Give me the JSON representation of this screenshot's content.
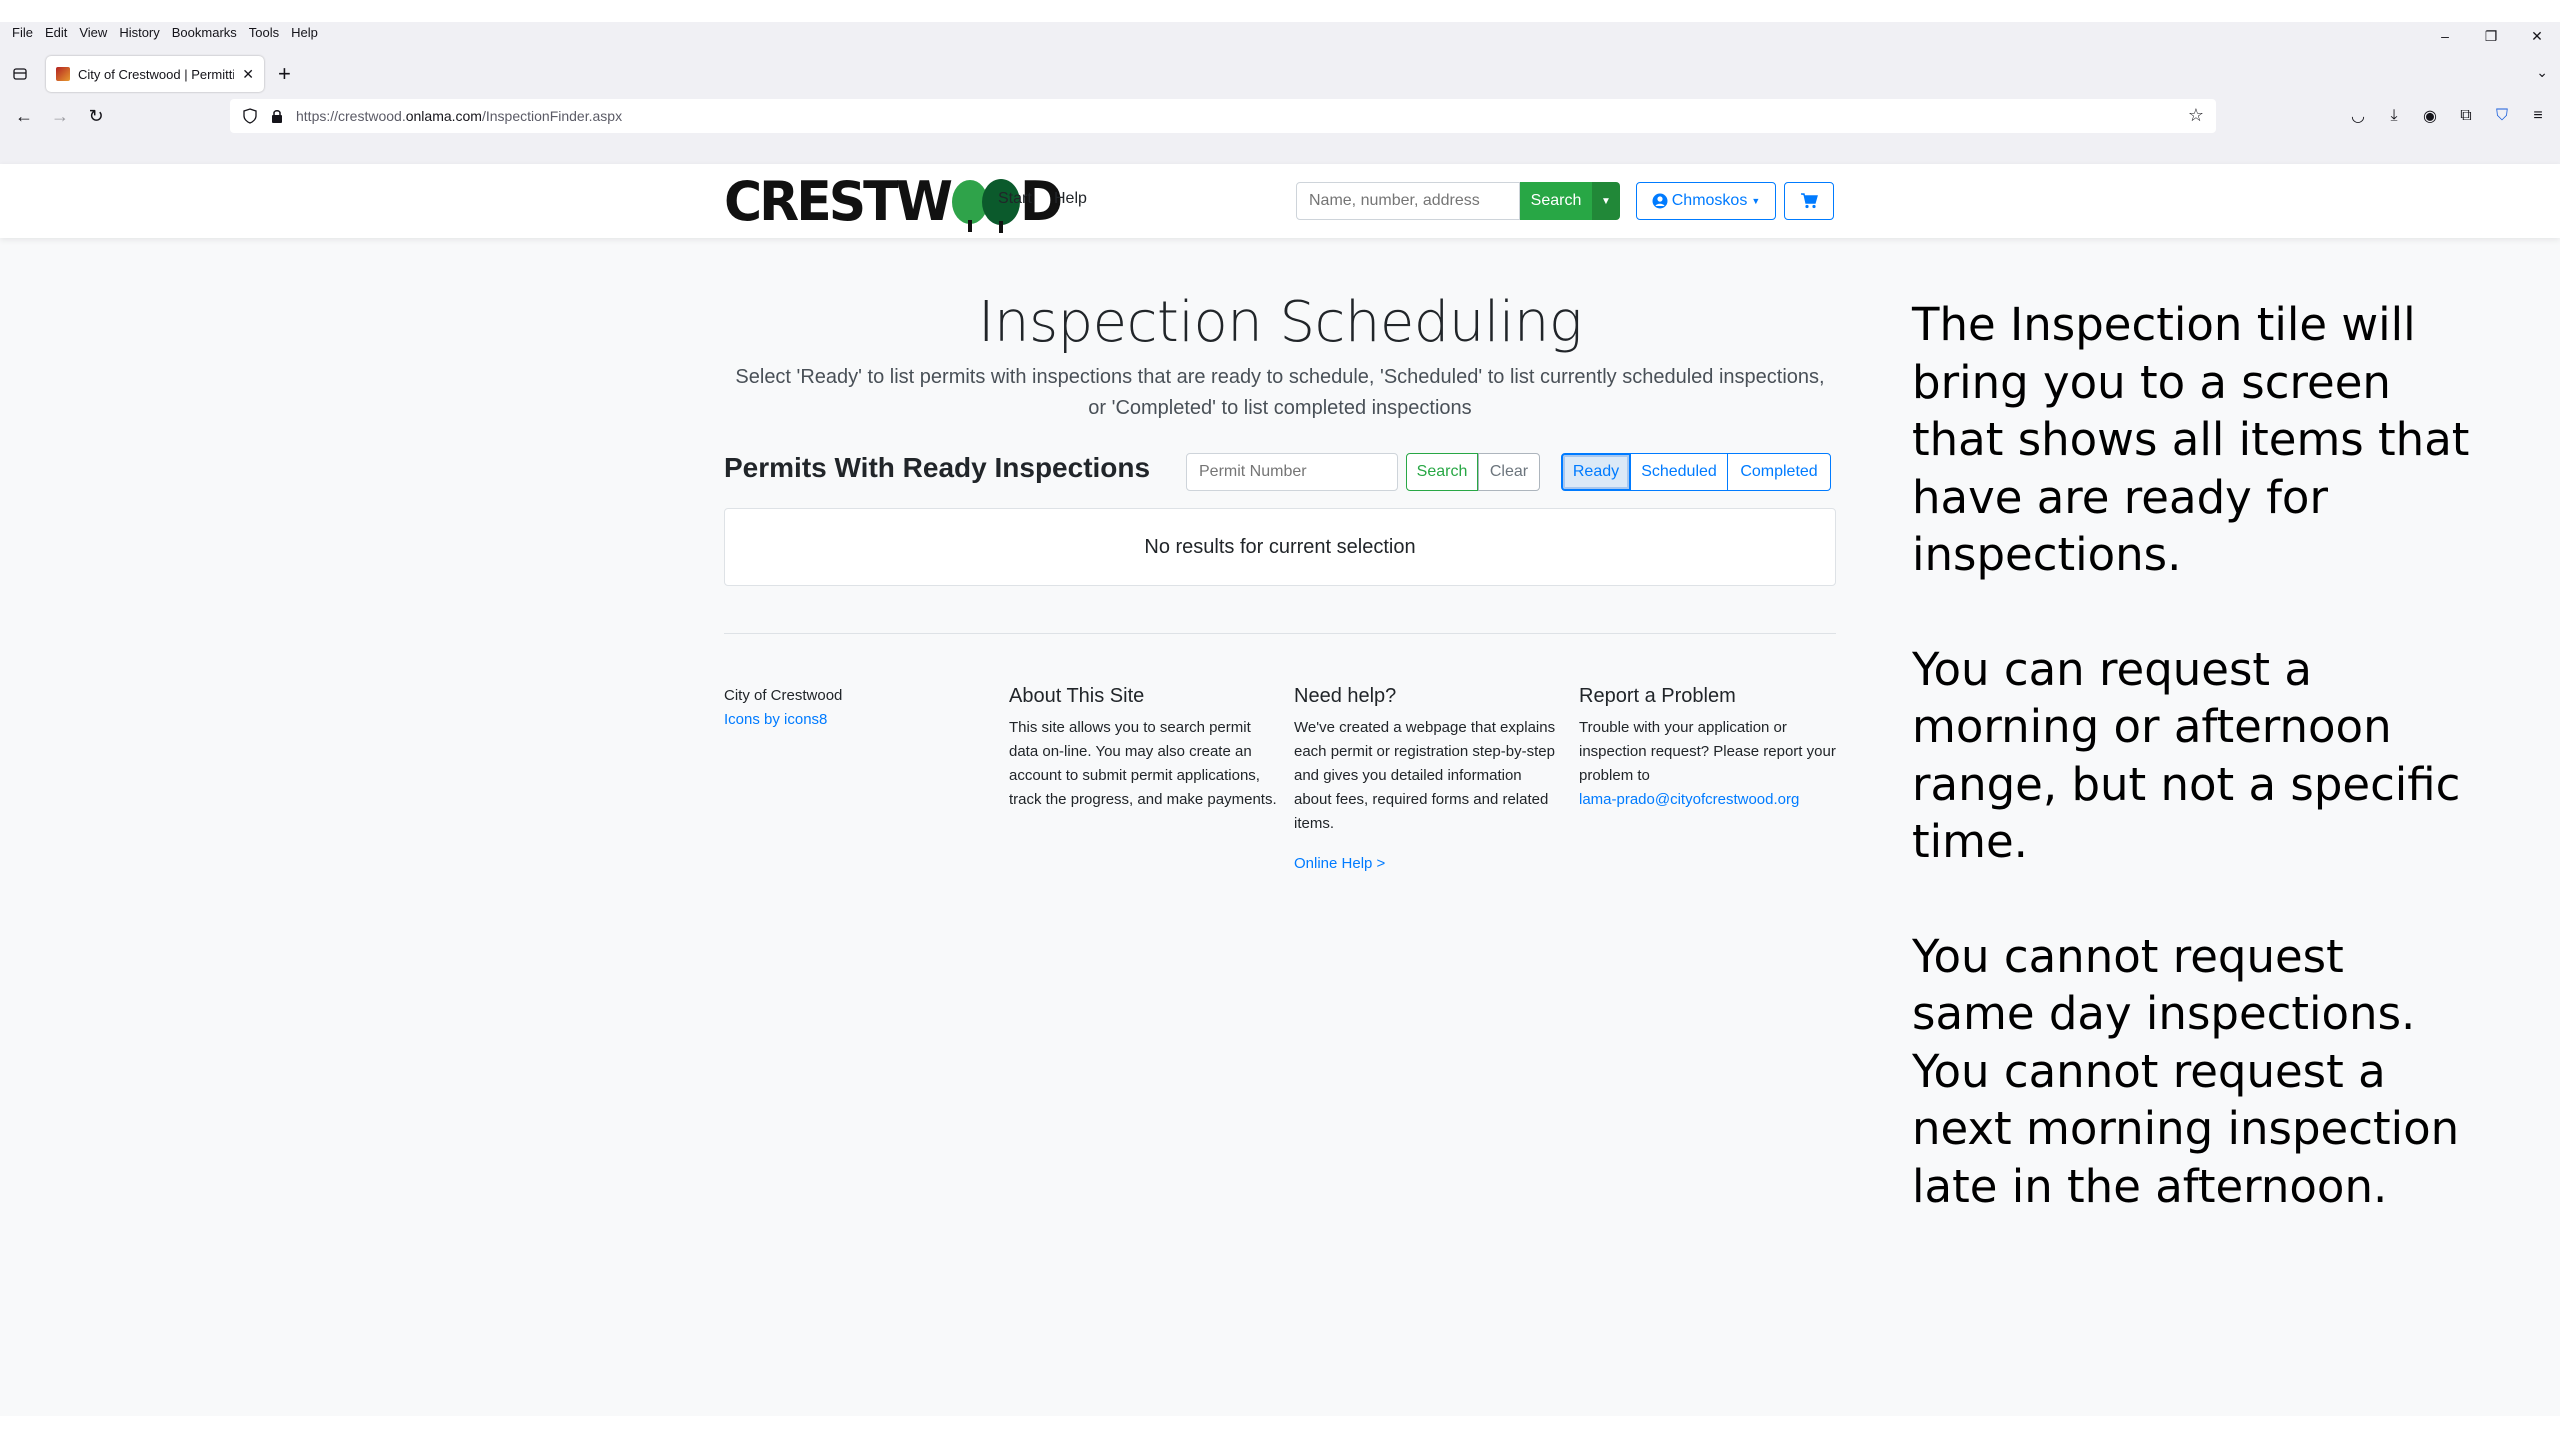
{
  "browser": {
    "menu": [
      "File",
      "Edit",
      "View",
      "History",
      "Bookmarks",
      "Tools",
      "Help"
    ],
    "tab_title": "City of Crestwood | Permitting",
    "url_prefix": "https://crestwood.",
    "url_domain": "onlama.com",
    "url_path": "/InspectionFinder.aspx"
  },
  "header": {
    "logo_text_left": "CRESTW",
    "logo_text_right": "D",
    "nav_start": "Start",
    "nav_help": "Help",
    "search_placeholder": "Name, number, address",
    "search_label": "Search",
    "user_label": "Chmoskos"
  },
  "main": {
    "title": "Inspection Scheduling",
    "lead": "Select 'Ready' to list permits with inspections that are ready to schedule, 'Scheduled' to list currently scheduled inspections, or 'Completed' to list completed inspections",
    "section_title": "Permits With Ready Inspections",
    "permit_placeholder": "Permit Number",
    "search_label": "Search",
    "clear_label": "Clear",
    "filters": [
      "Ready",
      "Scheduled",
      "Completed"
    ],
    "selected_filter": "Ready",
    "no_results": "No results for current selection"
  },
  "footer": {
    "col1": {
      "line1": "City of Crestwood",
      "link": "Icons by icons8"
    },
    "col2": {
      "title": "About This Site",
      "text": "This site allows you to search permit data on-line. You may also create an account to submit permit applications, track the progress, and make payments."
    },
    "col3": {
      "title": "Need help?",
      "text": "We've created a webpage that explains each permit or registration step-by-step and gives you detailed information about fees, required forms and related items.",
      "link": "Online Help >"
    },
    "col4": {
      "title": "Report a Problem",
      "text": "Trouble with your application or inspection request? Please report your problem to",
      "link": "lama-prado@cityofcrestwood.org"
    }
  },
  "side_note": {
    "p1": "The Inspection tile will bring you to a screen that shows all items that have are ready for inspections.",
    "p2": "You can request a morning or afternoon range, but not a specific time.",
    "p3": "You cannot request same day inspections. You cannot request a next morning inspection late in the afternoon."
  },
  "colors": {
    "success": "#28a745",
    "primary": "#007bff",
    "logo_light_tree": "#2fa34a",
    "logo_dark_tree": "#0b5a2c"
  }
}
